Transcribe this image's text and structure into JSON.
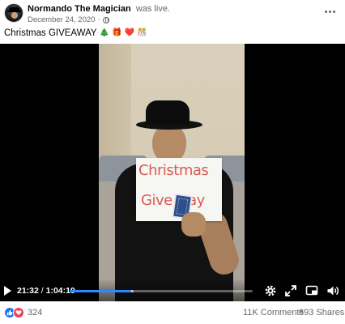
{
  "post": {
    "author": "Normando The Magician",
    "status": "was live.",
    "date": "December 24, 2020",
    "date_separator": "·",
    "caption": "Christmas GIVEAWAY",
    "caption_emojis": [
      "🎄",
      "🎁",
      "❤️",
      "🎊"
    ],
    "more_icon": "more-options-icon",
    "privacy_icon": "globe-icon"
  },
  "video": {
    "sign_line1": "Christmas",
    "sign_line2": "Give   way",
    "current_time": "21:32",
    "time_separator": "/",
    "duration": "1:04:19",
    "progress": 0.335,
    "buffered": 0.35,
    "controls": [
      "play-icon",
      "settings-icon",
      "fullscreen-icon",
      "picture-in-picture-icon",
      "volume-icon"
    ],
    "accent_color": "#2d88ff"
  },
  "footer": {
    "reactions": [
      "like",
      "love"
    ],
    "reaction_count": "324",
    "comments": "11K Comments",
    "shares": "693 Shares"
  }
}
